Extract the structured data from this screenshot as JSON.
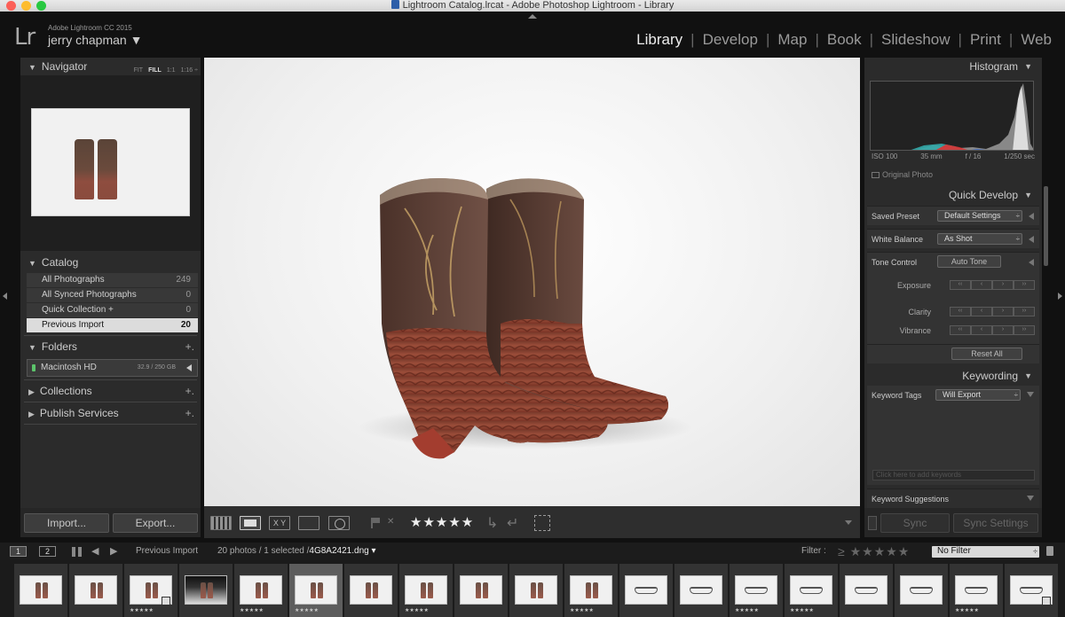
{
  "window": {
    "title": "Lightroom Catalog.lrcat - Adobe Photoshop Lightroom - Library"
  },
  "identity": {
    "logo": "Lr",
    "version": "Adobe Lightroom CC 2015",
    "user": "jerry chapman ▼"
  },
  "modules": [
    "Library",
    "Develop",
    "Map",
    "Book",
    "Slideshow",
    "Print",
    "Web"
  ],
  "active_module": "Library",
  "navigator": {
    "title": "Navigator",
    "zoom_options": [
      "FIT",
      "FILL",
      "1:1",
      "1:16 ÷"
    ],
    "selected_zoom": "FILL"
  },
  "catalog": {
    "title": "Catalog",
    "items": [
      {
        "label": "All Photographs",
        "count": "249"
      },
      {
        "label": "All Synced Photographs",
        "count": "0"
      },
      {
        "label": "Quick Collection +",
        "count": "0"
      },
      {
        "label": "Previous Import",
        "count": "20"
      }
    ]
  },
  "folders": {
    "title": "Folders",
    "add": "+.",
    "volume": {
      "name": "Macintosh HD",
      "size": "32.9 / 250 GB"
    }
  },
  "collections": {
    "title": "Collections",
    "add": "+."
  },
  "publish": {
    "title": "Publish Services",
    "add": "+."
  },
  "left_buttons": {
    "import": "Import...",
    "export": "Export..."
  },
  "toolbar": {
    "compare_label": "X Y",
    "rating": "★★★★★",
    "rotate_ccw": "↳",
    "rotate_cw": "↵"
  },
  "histogram": {
    "title": "Histogram",
    "readout": [
      "ISO 100",
      "35 mm",
      "f / 16",
      "1/250 sec"
    ],
    "original_photo": "Original Photo"
  },
  "quick_develop": {
    "title": "Quick Develop",
    "saved_preset_label": "Saved Preset",
    "saved_preset_value": "Default Settings",
    "white_balance_label": "White Balance",
    "white_balance_value": "As Shot",
    "tone_control_label": "Tone Control",
    "auto_tone": "Auto Tone",
    "exposure": "Exposure",
    "clarity": "Clarity",
    "vibrance": "Vibrance",
    "reset_all": "Reset All",
    "step_glyphs": [
      "‹‹",
      "‹",
      "›",
      "››"
    ]
  },
  "keywording": {
    "title": "Keywording",
    "tags_label": "Keyword Tags",
    "tags_value": "Will Export",
    "input_placeholder": "Click here to add keywords",
    "suggestions": "Keyword Suggestions"
  },
  "right_buttons": {
    "sync": "Sync",
    "sync_settings": "Sync Settings"
  },
  "filmstrip_bar": {
    "screen1": "1",
    "screen2": "2",
    "source": "Previous Import",
    "status_prefix": "20 photos / 1 selected /",
    "filename": "4G8A2421.dng ▾",
    "filter_label": "Filter :",
    "filter_stars": "≥ ★★★★★",
    "filter_value": "No Filter"
  },
  "filmstrip": {
    "selected_index": 5,
    "thumbnails": [
      {
        "kind": "boot",
        "stars": ""
      },
      {
        "kind": "boot",
        "stars": ""
      },
      {
        "kind": "boot",
        "stars": "★★★★★",
        "badge": true
      },
      {
        "kind": "dark",
        "stars": ""
      },
      {
        "kind": "boot",
        "stars": "★★★★★"
      },
      {
        "kind": "boot",
        "stars": "★★★★★"
      },
      {
        "kind": "boot",
        "stars": ""
      },
      {
        "kind": "boot",
        "stars": "★★★★★"
      },
      {
        "kind": "boot",
        "stars": ""
      },
      {
        "kind": "boot",
        "stars": ""
      },
      {
        "kind": "boot",
        "stars": "★★★★★"
      },
      {
        "kind": "glasses",
        "stars": ""
      },
      {
        "kind": "glasses",
        "stars": ""
      },
      {
        "kind": "glasses",
        "stars": "★★★★★"
      },
      {
        "kind": "glasses",
        "stars": "★★★★★"
      },
      {
        "kind": "glasses",
        "stars": ""
      },
      {
        "kind": "glasses",
        "stars": ""
      },
      {
        "kind": "glasses",
        "stars": "★★★★★"
      },
      {
        "kind": "glasses",
        "stars": "",
        "badge": true
      }
    ]
  },
  "colors": {
    "panel": "#2b2b2b",
    "background": "#111111",
    "boot_brown": "#8e4d3f",
    "boot_top": "#5a4438"
  }
}
